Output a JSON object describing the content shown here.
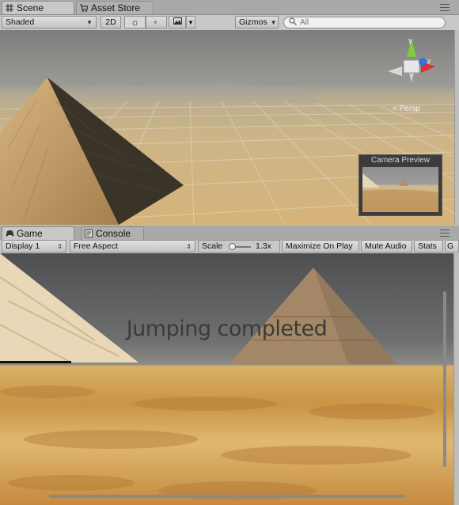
{
  "scene_tabs": {
    "scene": "Scene",
    "asset_store": "Asset Store"
  },
  "scene_toolbar": {
    "shading_mode": "Shaded",
    "mode_2d": "2D",
    "gizmos": "Gizmos",
    "search_placeholder": "All"
  },
  "scene_view": {
    "perspective_label": "Persp",
    "camera_preview_title": "Camera Preview"
  },
  "game_tabs": {
    "game": "Game",
    "console": "Console"
  },
  "game_toolbar": {
    "display": "Display 1",
    "aspect": "Free Aspect",
    "scale_label": "Scale",
    "scale_value": "1.3x",
    "maximize_on_play": "Maximize On Play",
    "mute_audio": "Mute Audio",
    "stats": "Stats",
    "gizmos_partial": "G"
  },
  "game_view": {
    "overlay_text": "Jumping completed"
  },
  "colors": {
    "tab_active": "#c8c8c8",
    "tab_inactive": "#b0b0b0",
    "gizmo_y": "#7ecb3c",
    "gizmo_x": "#e03030",
    "gizmo_z": "#3a6fd8"
  }
}
